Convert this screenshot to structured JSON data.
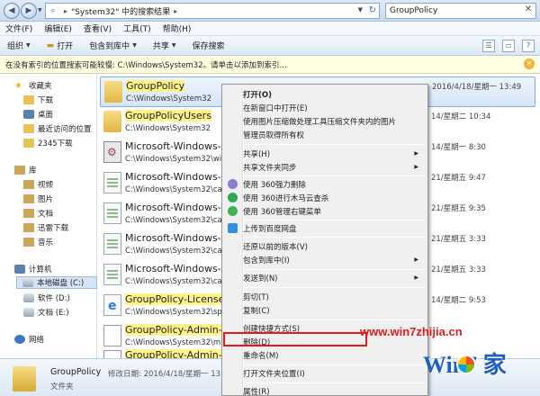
{
  "address": {
    "path_label": "\"System32\" 中的搜索结果",
    "search_value": "GroupPolicy"
  },
  "menubar": [
    "文件(F)",
    "编辑(E)",
    "查看(V)",
    "工具(T)",
    "帮助(H)"
  ],
  "toolbar": {
    "organize": "组织",
    "open": "打开",
    "include": "包含到库中",
    "share": "共享",
    "save_search": "保存搜索"
  },
  "infobar": {
    "text": "在没有索引的位置搜索可能较慢: C:\\Windows\\System32。请单击以添加到索引..."
  },
  "nav": {
    "favorites": "收藏夹",
    "downloads": "下载",
    "desktop": "桌面",
    "recent": "最近访问的位置",
    "d2345": "2345下载",
    "libraries": "库",
    "videos": "视频",
    "pictures": "图片",
    "documents": "文档",
    "xunlei": "迅雷下载",
    "music": "音乐",
    "computer": "计算机",
    "local_c": "本地磁盘 (C:)",
    "soft_d": "软件 (D:)",
    "docs_e": "文档 (E:)",
    "network": "网络"
  },
  "files": [
    {
      "name": "GroupPolicy",
      "path": "C:\\Windows\\System32",
      "date": "2016/4/18/星期一 13:49"
    },
    {
      "name": "GroupPolicyUsers",
      "path": "C:\\Windows\\System32",
      "date": "14/星期二 10:34"
    },
    {
      "name": "Microsoft-Windows-G",
      "path": "C:\\Windows\\System32\\win",
      "date": "14/星期一 8:30"
    },
    {
      "name": "Microsoft-Windows-G",
      "path": "C:\\Windows\\System32\\catr",
      "date": "21/星期五 9:47"
    },
    {
      "name": "Microsoft-Windows-G",
      "path": "C:\\Windows\\System32\\catr",
      "date": "21/星期五 9:35"
    },
    {
      "name": "Microsoft-Windows-G",
      "path": "C:\\Windows\\System32\\catr",
      "date": "21/星期五 3:33"
    },
    {
      "name": "Microsoft-Windows-G",
      "path": "C:\\Windows\\System32\\catr",
      "date": "21/星期五 3:33"
    },
    {
      "name": "GroupPolicy-License-",
      "path": "C:\\Windows\\System32\\spp",
      "date": "14/星期二 9:53"
    },
    {
      "name": "GroupPolicy-Admin-G",
      "path": "C:\\Windows\\System32\\mig",
      "date": ""
    },
    {
      "name": "GroupPolicy-Admin-G",
      "path": "C:\\Windows\\System32\\mig",
      "date": ""
    }
  ],
  "context_menu": {
    "open": "打开(O)",
    "open_new_window": "在新窗口中打开(E)",
    "compress_pics": "使用图片压缩做处理工具压缩文件夹内的图片",
    "take_ownership": "管理员取得所有权",
    "share": "共享(H)",
    "share_sync": "共享文件夹同步",
    "force_delete": "使用 360强力删除",
    "trojan_scan": "使用 360进行木马云查杀",
    "manage_menu": "使用 360管理右键菜单",
    "baidu_upload": "上传到百度网盘",
    "restore_prev": "还原以前的版本(V)",
    "include_library": "包含到库中(I)",
    "send_to": "发送到(N)",
    "cut": "剪切(T)",
    "copy": "复制(C)",
    "create_shortcut": "创建快捷方式(S)",
    "delete": "删除(D)",
    "rename": "重命名(M)",
    "open_location": "打开文件夹位置(I)",
    "properties": "属性(R)"
  },
  "details": {
    "name": "GroupPolicy",
    "meta": "修改日期: 2016/4/18/星期一 13:49",
    "type": "文件夹"
  },
  "watermark": {
    "url": "www.win7zhijia.cn",
    "logo_text": "Win7 家"
  },
  "colors": {
    "highlight": "#fff48c",
    "delete_box": "#e21a1a",
    "selection": "#d4e5f8"
  }
}
